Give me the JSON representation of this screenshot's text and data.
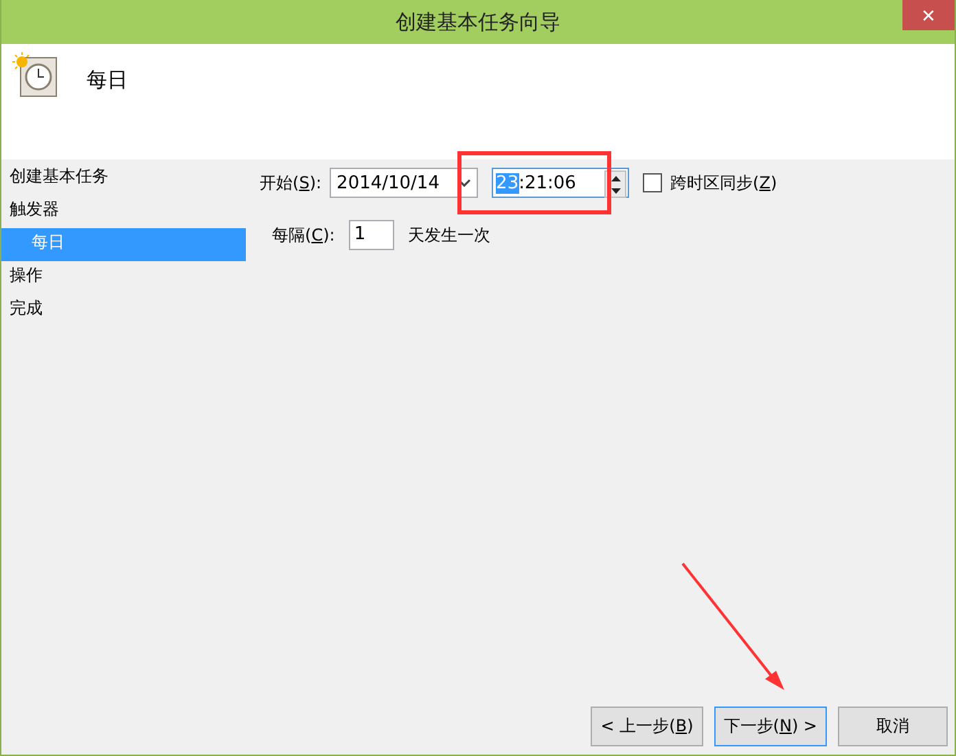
{
  "window": {
    "title": "创建基本任务向导",
    "close": "✕"
  },
  "header": {
    "title": "每日"
  },
  "sidebar": {
    "items": [
      {
        "label": "创建基本任务",
        "selected": false
      },
      {
        "label": "触发器",
        "selected": false,
        "children": [
          {
            "label": "每日",
            "selected": true
          }
        ]
      },
      {
        "label": "操作",
        "selected": false
      },
      {
        "label": "完成",
        "selected": false
      }
    ]
  },
  "start": {
    "label_before": "开始(",
    "key": "S",
    "label_after": "):",
    "date": "2014/10/14",
    "time_parts": [
      {
        "text": "23",
        "selected": true
      },
      {
        "text": ":21:06",
        "selected": false
      }
    ],
    "sync": {
      "label_before": "跨时区同步(",
      "key": "Z",
      "label_after": ")",
      "checked": false
    }
  },
  "recur": {
    "label_before": "每隔(",
    "key": "C",
    "label_after": "):",
    "value": "1",
    "unit": "天发生一次"
  },
  "buttons": [
    {
      "before": "< 上一步(",
      "key": "B",
      "after": ")",
      "focused": false
    },
    {
      "before": "下一步(",
      "key": "N",
      "after": ") >",
      "focused": true
    },
    {
      "before": "取消",
      "focused": false
    }
  ],
  "annotations": {
    "highlight_box": true,
    "pointer_arrow": true
  }
}
